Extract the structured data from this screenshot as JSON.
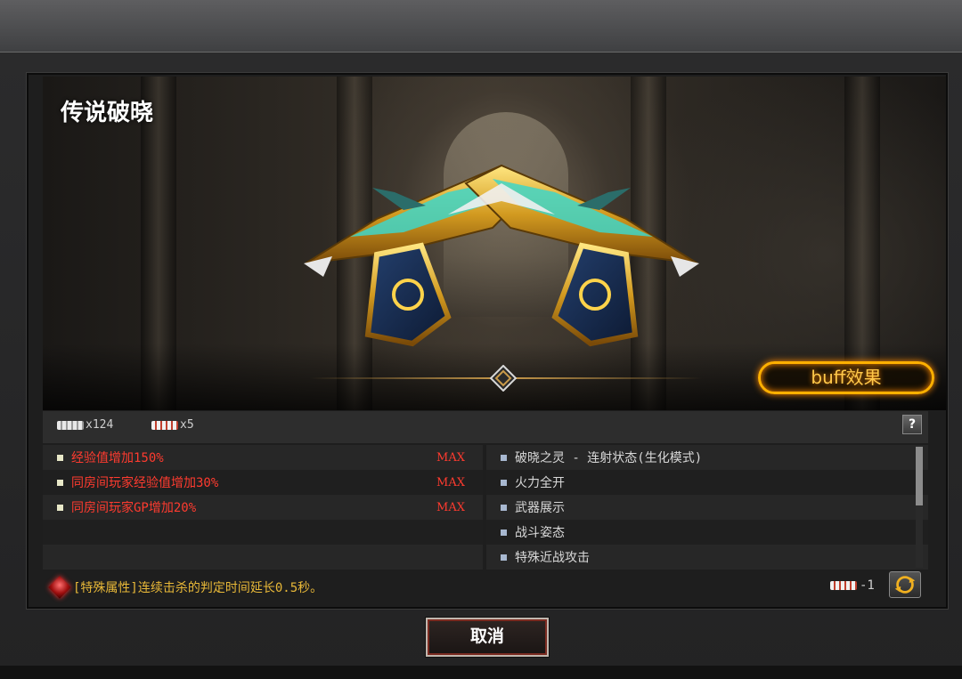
{
  "dialog": {
    "title": "传说破晓",
    "buff_button_label": "buff效果",
    "help_label": "?"
  },
  "tickets": [
    {
      "icon": "silver-ticket-icon",
      "count_label": "x124"
    },
    {
      "icon": "red-ticket-icon",
      "count_label": "x5"
    }
  ],
  "left_attributes": [
    {
      "text": "经验值增加150%",
      "tag": "MAX"
    },
    {
      "text": "同房间玩家经验值增加30%",
      "tag": "MAX"
    },
    {
      "text": "同房间玩家GP增加20%",
      "tag": "MAX"
    },
    {
      "text": "",
      "tag": ""
    },
    {
      "text": "",
      "tag": ""
    }
  ],
  "right_attributes": [
    {
      "text": "破晓之灵 - 连射状态(生化模式)"
    },
    {
      "text": "火力全开"
    },
    {
      "text": "武器展示"
    },
    {
      "text": "战斗姿态"
    },
    {
      "text": "特殊近战攻击"
    }
  ],
  "special": {
    "text": "[特殊属性]连续击杀的判定时间延长0.5秒。"
  },
  "cost": {
    "label": "-1"
  },
  "footer": {
    "cancel_label": "取消"
  },
  "colors": {
    "accent_gold": "#ffb000",
    "attribute_red": "#ff3b2f",
    "special_yellow": "#e8b838"
  }
}
